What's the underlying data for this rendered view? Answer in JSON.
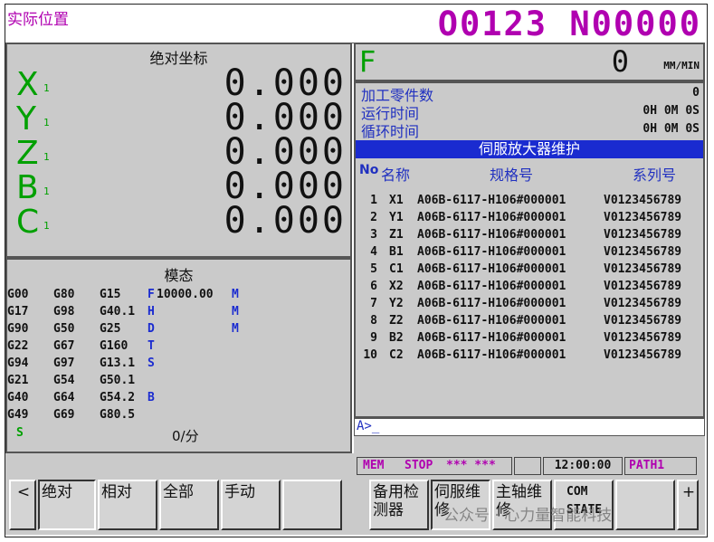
{
  "header": {
    "mode_title": "实际位置",
    "program_number": "O0123 N00000"
  },
  "position": {
    "title": "绝对坐标",
    "axes": [
      {
        "name": "X",
        "sub": "1",
        "value": "0.000"
      },
      {
        "name": "Y",
        "sub": "1",
        "value": "0.000"
      },
      {
        "name": "Z",
        "sub": "1",
        "value": "0.000"
      },
      {
        "name": "B",
        "sub": "1",
        "value": "0.000"
      },
      {
        "name": "C",
        "sub": "1",
        "value": "0.000"
      }
    ]
  },
  "modal": {
    "title": "模态",
    "rows": [
      [
        "G00",
        "G80",
        "G15"
      ],
      [
        "G17",
        "G98",
        "G40.1"
      ],
      [
        "G90",
        "G50",
        "G25"
      ],
      [
        "G22",
        "G67",
        "G160"
      ],
      [
        "G94",
        "G97",
        "G13.1"
      ],
      [
        "G21",
        "G54",
        "G50.1"
      ],
      [
        "G40",
        "G64",
        "G54.2"
      ],
      [
        "G49",
        "G69",
        "G80.5"
      ]
    ],
    "markers": [
      "F",
      "H",
      "D",
      "T",
      "S",
      "",
      "B",
      ""
    ],
    "f_value": "10000.00",
    "m_markers": [
      "M",
      "M",
      "M"
    ],
    "s_label": "S",
    "s_value": "0/分"
  },
  "feed": {
    "label": "F",
    "value": "0",
    "unit": "MM/MIN"
  },
  "info": {
    "parts_label": "加工零件数",
    "parts_value": "0",
    "run_time_label": "运行时间",
    "run_time_value": "0H 0M 0S",
    "cycle_time_label": "循环时间",
    "cycle_time_value": "0H 0M 0S"
  },
  "servo": {
    "title": "伺服放大器维护",
    "col_no": "No",
    "col_name": "名称",
    "col_spec": "规格号",
    "col_serial": "系列号",
    "rows": [
      {
        "no": "1",
        "name": "X1",
        "spec": "A06B-6117-H106#000001",
        "serial": "V0123456789"
      },
      {
        "no": "2",
        "name": "Y1",
        "spec": "A06B-6117-H106#000001",
        "serial": "V0123456789"
      },
      {
        "no": "3",
        "name": "Z1",
        "spec": "A06B-6117-H106#000001",
        "serial": "V0123456789"
      },
      {
        "no": "4",
        "name": "B1",
        "spec": "A06B-6117-H106#000001",
        "serial": "V0123456789"
      },
      {
        "no": "5",
        "name": "C1",
        "spec": "A06B-6117-H106#000001",
        "serial": "V0123456789"
      },
      {
        "no": "6",
        "name": "X2",
        "spec": "A06B-6117-H106#000001",
        "serial": "V0123456789"
      },
      {
        "no": "7",
        "name": "Y2",
        "spec": "A06B-6117-H106#000001",
        "serial": "V0123456789"
      },
      {
        "no": "8",
        "name": "Z2",
        "spec": "A06B-6117-H106#000001",
        "serial": "V0123456789"
      },
      {
        "no": "9",
        "name": "B2",
        "spec": "A06B-6117-H106#000001",
        "serial": "V0123456789"
      },
      {
        "no": "10",
        "name": "C2",
        "spec": "A06B-6117-H106#000001",
        "serial": "V0123456789"
      }
    ]
  },
  "input_prompt": "A>_",
  "status": {
    "mode": "MEM",
    "state": "STOP",
    "alarm": "*** ***",
    "time": "12:00:00",
    "path": "PATH1"
  },
  "softkeys": {
    "left_arrow": "<",
    "abs": "绝对",
    "rel": "相对",
    "all": "全部",
    "manual": "手动",
    "checker": "备用检测器",
    "servo": "伺服维修",
    "spindle": "主轴维修",
    "com_state": "COM STATE",
    "plus": "+"
  },
  "watermark": "公众号 · 心力量智能科技",
  "colors": {
    "accent_magenta": "#b000b0",
    "axis_green": "#00a000",
    "label_blue": "#2030c0",
    "bar_blue": "#1a2bd0",
    "panel_gray": "#cacaca"
  }
}
